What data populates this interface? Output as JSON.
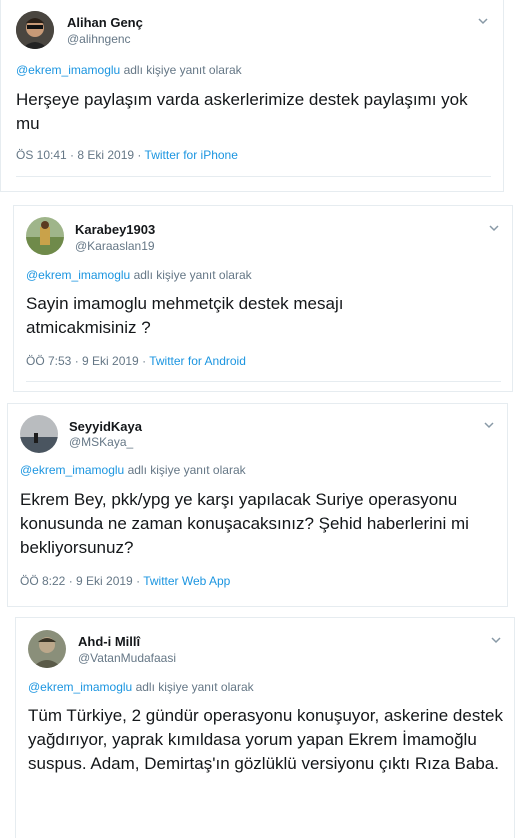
{
  "tweets": [
    {
      "name": "Alihan Genç",
      "handle": "@alihngenc",
      "reply_mention": "@ekrem_imamoglu",
      "reply_suffix": "adlı kişiye yanıt olarak",
      "text": "Herşeye paylaşım varda askerlerimize destek paylaşımı yok mu",
      "time": "ÖS 10:41 · 8 Eki 2019 · ",
      "source": "Twitter for iPhone"
    },
    {
      "name": "Karabey1903",
      "handle": "@Karaaslan19",
      "reply_mention": "@ekrem_imamoglu",
      "reply_suffix": "adlı kişiye yanıt olarak",
      "text": "Sayin imamoglu mehmetçik destek mesajı atmicakmisiniz ?",
      "time": "ÖÖ 7:53 · 9 Eki 2019 · ",
      "source": "Twitter for Android"
    },
    {
      "name": "SeyyidKaya",
      "handle": "@MSKaya_",
      "reply_mention": "@ekrem_imamoglu",
      "reply_suffix": "adlı kişiye yanıt olarak",
      "text": "Ekrem Bey, pkk/ypg ye karşı yapılacak Suriye operasyonu konusunda ne zaman konuşacaksınız? Şehid haberlerini mi bekliyorsunuz?",
      "time": "ÖÖ 8:22 · 9 Eki 2019 · ",
      "source": "Twitter Web App"
    },
    {
      "name": "Ahd-i Millî",
      "handle": "@VatanMudafaasi",
      "reply_mention": "@ekrem_imamoglu",
      "reply_suffix": "adlı kişiye yanıt olarak",
      "text": "Tüm Türkiye, 2 gündür operasyonu konuşuyor, askerine destek yağdırıyor, yaprak kımıldasa yorum yapan Ekrem İmamoğlu suspus. Adam, Demirtaş'ın gözlüklü versiyonu çıktı Rıza Baba."
    }
  ]
}
